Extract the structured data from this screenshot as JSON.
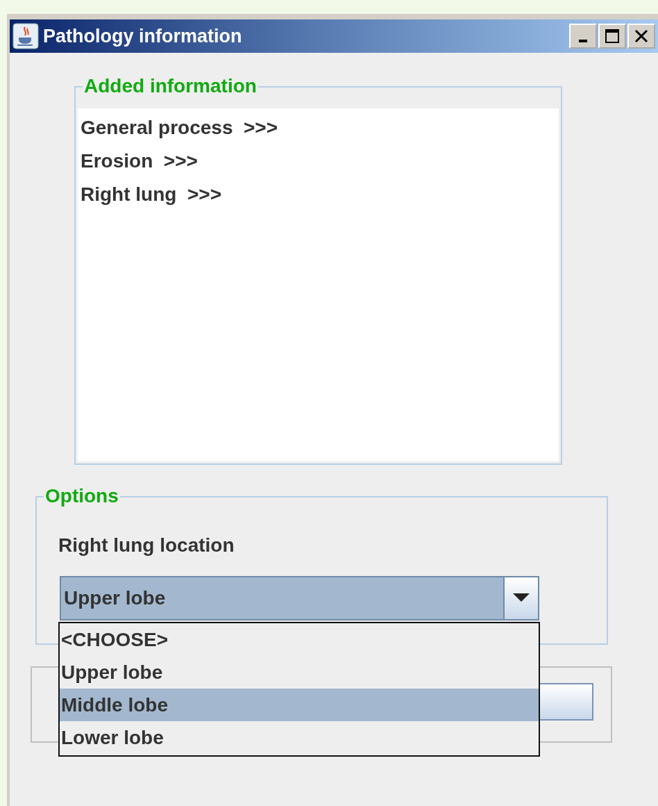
{
  "window": {
    "title": "Pathology information"
  },
  "added_information": {
    "legend": "Added information",
    "items": [
      "General process  >>>",
      "Erosion  >>>",
      "Right lung  >>>"
    ]
  },
  "options": {
    "legend": "Options",
    "label": "Right lung location",
    "dropdown": {
      "value": "Upper lobe",
      "expanded": true,
      "options": [
        {
          "label": "<CHOOSE>",
          "highlighted": false
        },
        {
          "label": "Upper lobe",
          "highlighted": false
        },
        {
          "label": "Middle lobe",
          "highlighted": true
        },
        {
          "label": "Lower lobe",
          "highlighted": false
        }
      ]
    }
  }
}
